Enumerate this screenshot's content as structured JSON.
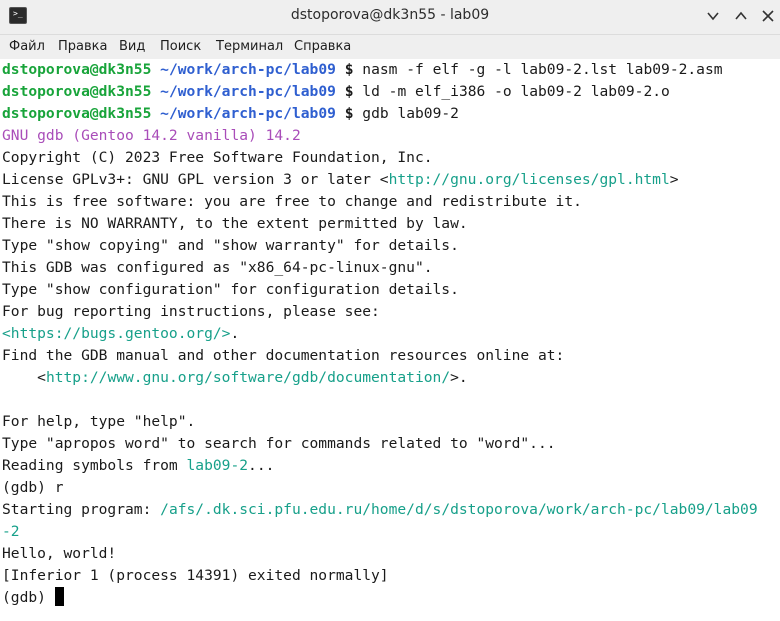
{
  "window": {
    "title": "dstoporova@dk3n55 - lab09",
    "icon": "terminal-icon",
    "buttons": [
      "minimize-icon",
      "maximize-icon",
      "close-icon"
    ]
  },
  "menu": [
    "Файл",
    "Правка",
    "Вид",
    "Поиск",
    "Терминал",
    "Справка"
  ],
  "prompt": {
    "user": "dstoporova@dk3n55",
    "path": "~/work/arch-pc/lab09",
    "symbol": "$"
  },
  "commands": [
    "nasm -f elf -g -l lab09-2.lst lab09-2.asm",
    "ld -m elf_i386 -o lab09-2 lab09-2.o",
    "gdb lab09-2"
  ],
  "gdb_banner": "GNU gdb (Gentoo 14.2 vanilla) 14.2",
  "output": {
    "copyright": "Copyright (C) 2023 Free Software Foundation, Inc.",
    "license_prefix": "License GPLv3+: GNU GPL version 3 or later <",
    "license_url": "http://gnu.org/licenses/gpl.html",
    "license_suffix": ">",
    "free": "This is free software: you are free to change and redistribute it.",
    "warranty": "There is NO WARRANTY, to the extent permitted by law.",
    "show": "Type \"show copying\" and \"show warranty\" for details.",
    "configured": "This GDB was configured as \"x86_64-pc-linux-gnu\".",
    "config": "Type \"show configuration\" for configuration details.",
    "bugs": "For bug reporting instructions, please see:",
    "bugs_url": "<https://bugs.gentoo.org/>",
    "bugs_suffix": ".",
    "manual": "Find the GDB manual and other documentation resources online at:",
    "doc_prefix": "    <",
    "doc_url": "http://www.gnu.org/software/gdb/documentation/",
    "doc_suffix": ">.",
    "help": "For help, type \"help\".",
    "apropos": "Type \"apropos word\" to search for commands related to \"word\"...",
    "reading_prefix": "Reading symbols from ",
    "reading_file": "lab09-2",
    "reading_suffix": "...",
    "run_cmd": "(gdb) r",
    "starting_prefix": "Starting program: ",
    "starting_path_1": "/afs/.dk.sci.pfu.edu.ru/home/d/s/dstoporova/work/arch-pc/lab09/lab09",
    "starting_path_2": "-2",
    "hello": "Hello, world!",
    "inferior": "[Inferior 1 (process 14391) exited normally]",
    "gdb_prompt": "(gdb) "
  },
  "colors": {
    "user": "#18a43a",
    "path": "#2f5fd0",
    "banner": "#a94db9",
    "link": "#17a08a"
  }
}
